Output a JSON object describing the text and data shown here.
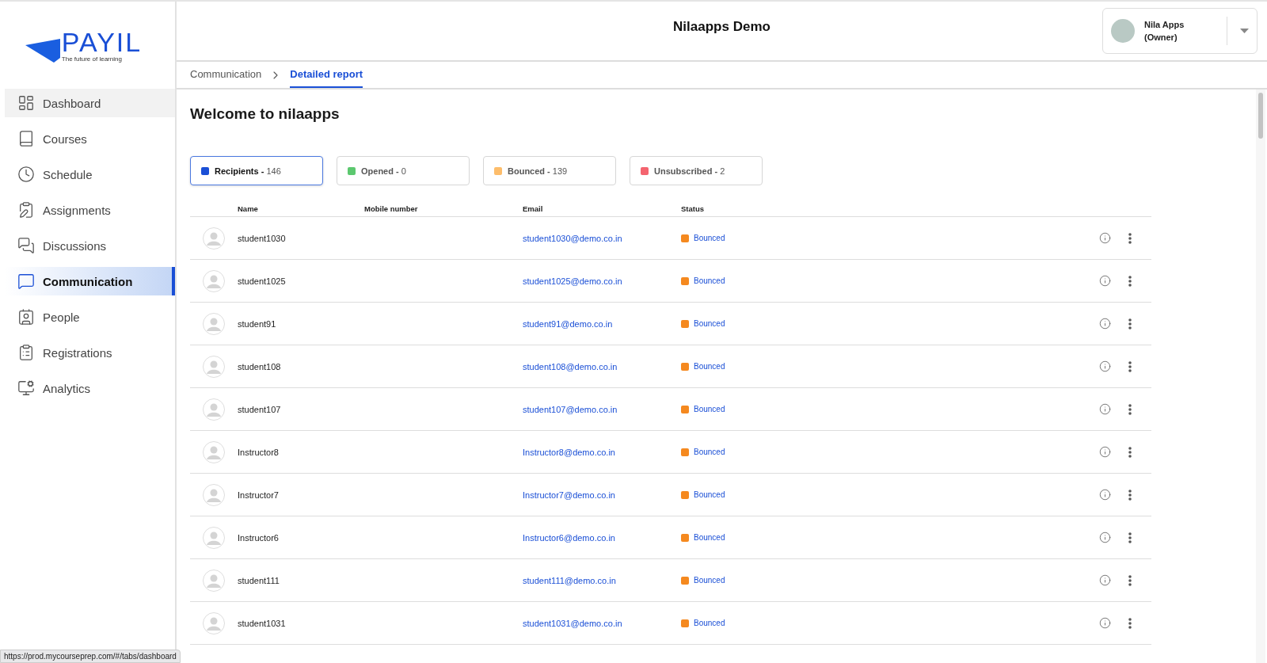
{
  "logo": {
    "wordmark": "PAYIL",
    "tagline": "The future of learning"
  },
  "header": {
    "title": "Nilaapps Demo",
    "user": {
      "name": "Nila Apps",
      "role": "(Owner)"
    }
  },
  "sidebar": {
    "items": [
      {
        "label": "Dashboard",
        "selected": false,
        "hovered": true
      },
      {
        "label": "Courses",
        "selected": false,
        "hovered": false
      },
      {
        "label": "Schedule",
        "selected": false,
        "hovered": false
      },
      {
        "label": "Assignments",
        "selected": false,
        "hovered": false
      },
      {
        "label": "Discussions",
        "selected": false,
        "hovered": false
      },
      {
        "label": "Communication",
        "selected": true,
        "hovered": false
      },
      {
        "label": "People",
        "selected": false,
        "hovered": false
      },
      {
        "label": "Registrations",
        "selected": false,
        "hovered": false
      },
      {
        "label": "Analytics",
        "selected": false,
        "hovered": false
      }
    ]
  },
  "breadcrumb": [
    {
      "label": "Communication",
      "selected": false
    },
    {
      "label": "Detailed report",
      "selected": true
    }
  ],
  "heading": "Welcome to nilaapps",
  "filters": [
    {
      "label": "Recipients -",
      "count": "146",
      "color": "#1a4fd6",
      "selected": true
    },
    {
      "label": "Opened -",
      "count": "0",
      "color": "#5cc86f",
      "selected": false
    },
    {
      "label": "Bounced -",
      "count": "139",
      "color": "#fdbd6b",
      "selected": false
    },
    {
      "label": "Unsubscribed -",
      "count": "2",
      "color": "#f4646f",
      "selected": false
    }
  ],
  "table": {
    "columns": [
      "Name",
      "Mobile number",
      "Email",
      "Status"
    ],
    "rows": [
      {
        "name": "student1030",
        "email": "student1030@demo.co.in",
        "status": "Bounced",
        "color": "#f5891f"
      },
      {
        "name": "student1025",
        "email": "student1025@demo.co.in",
        "status": "Bounced",
        "color": "#f5891f"
      },
      {
        "name": "student91",
        "email": "student91@demo.co.in",
        "status": "Bounced",
        "color": "#f5891f"
      },
      {
        "name": "student108",
        "email": "student108@demo.co.in",
        "status": "Bounced",
        "color": "#f5891f"
      },
      {
        "name": "student107",
        "email": "student107@demo.co.in",
        "status": "Bounced",
        "color": "#f5891f"
      },
      {
        "name": "Instructor8",
        "email": "Instructor8@demo.co.in",
        "status": "Bounced",
        "color": "#f5891f"
      },
      {
        "name": "Instructor7",
        "email": "Instructor7@demo.co.in",
        "status": "Bounced",
        "color": "#f5891f"
      },
      {
        "name": "Instructor6",
        "email": "Instructor6@demo.co.in",
        "status": "Bounced",
        "color": "#f5891f"
      },
      {
        "name": "student111",
        "email": "student111@demo.co.in",
        "status": "Bounced",
        "color": "#f5891f"
      },
      {
        "name": "student1031",
        "email": "student1031@demo.co.in",
        "status": "Bounced",
        "color": "#f5891f"
      }
    ]
  },
  "status_url": "https://prod.mycourseprep.com/#/tabs/dashboard"
}
